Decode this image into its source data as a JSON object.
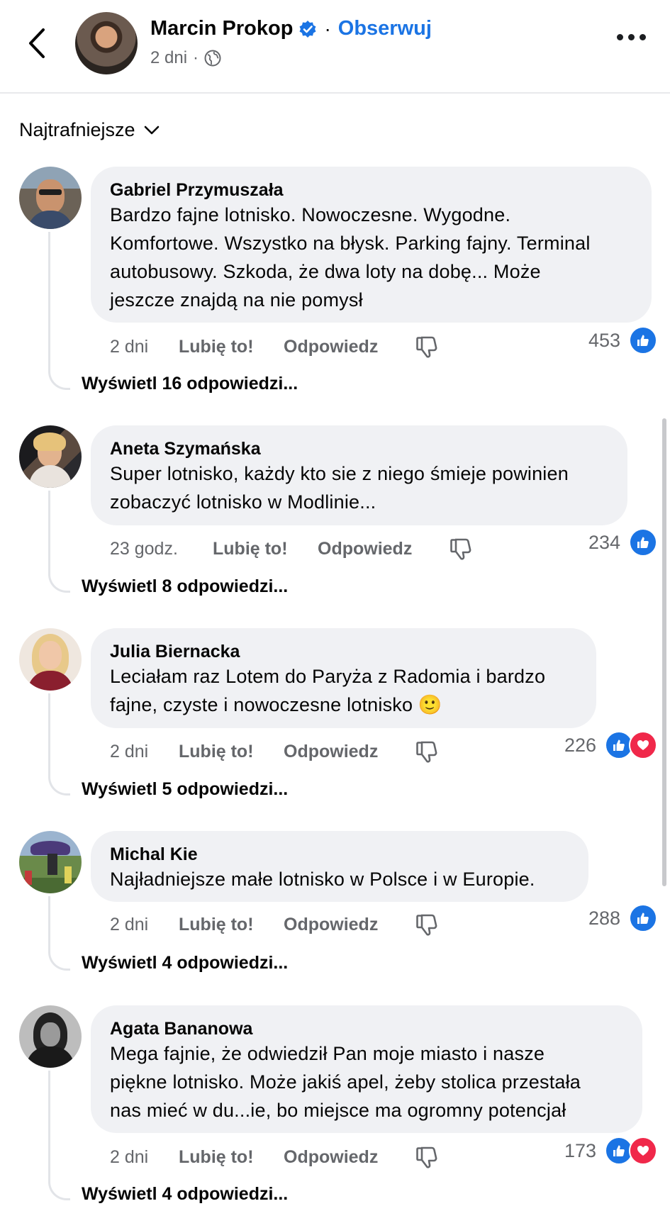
{
  "header": {
    "name": "Marcin Prokop",
    "separator": "·",
    "follow_label": "Obserwuj",
    "time": "2 dni",
    "meta_separator": "·"
  },
  "sort": {
    "label": "Najtrafniejsze"
  },
  "colors": {
    "accent": "#1b74e4",
    "love": "#f0284a",
    "bubble": "#f0f1f4",
    "muted": "#65676b"
  },
  "comments": [
    {
      "author": "Gabriel Przymuszała",
      "lines": [
        "Bardzo fajne lotnisko. Nowoczesne. Wygodne.",
        "Komfortowe. Wszystko na błysk. Parking fajny. Terminal",
        "autobusowy. Szkoda, że dwa loty na dobę... Może",
        "jeszcze znajdą na nie pomysł"
      ],
      "time": "2 dni",
      "like_label": "Lubię to!",
      "reply_label": "Odpowiedz",
      "reaction_count": "453",
      "reactions": [
        "like-icon"
      ],
      "view_replies": "Wyświetl 16 odpowiedzi..."
    },
    {
      "author": "Aneta Szymańska",
      "lines": [
        "Super lotnisko, każdy kto sie z niego śmieje powinien",
        "zobaczyć lotnisko w Modlinie..."
      ],
      "time": "23 godz.",
      "like_label": "Lubię to!",
      "reply_label": "Odpowiedz",
      "reaction_count": "234",
      "reactions": [
        "like-icon"
      ],
      "view_replies": "Wyświetl 8 odpowiedzi..."
    },
    {
      "author": "Julia Biernacka",
      "lines": [
        "Leciałam raz Lotem do Paryża z Radomia i bardzo",
        "fajne, czyste i nowoczesne lotnisko 🙂"
      ],
      "time": "2 dni",
      "like_label": "Lubię to!",
      "reply_label": "Odpowiedz",
      "reaction_count": "226",
      "reactions": [
        "like-icon",
        "love-icon"
      ],
      "view_replies": "Wyświetl 5 odpowiedzi..."
    },
    {
      "author": "Michal Kie",
      "lines": [
        "Najładniejsze małe lotnisko w Polsce i w Europie."
      ],
      "time": "2 dni",
      "like_label": "Lubię to!",
      "reply_label": "Odpowiedz",
      "reaction_count": "288",
      "reactions": [
        "like-icon"
      ],
      "view_replies": "Wyświetl 4 odpowiedzi..."
    },
    {
      "author": "Agata Bananowa",
      "lines": [
        "Mega fajnie, że odwiedził Pan moje miasto i nasze",
        "piękne lotnisko. Może jakiś apel, żeby stolica przestała",
        "nas mieć w du...ie, bo miejsce ma ogromny potencjał"
      ],
      "time": "2 dni",
      "like_label": "Lubię to!",
      "reply_label": "Odpowiedz",
      "reaction_count": "173",
      "reactions": [
        "like-icon",
        "love-icon"
      ],
      "view_replies": "Wyświetl 4 odpowiedzi..."
    }
  ]
}
